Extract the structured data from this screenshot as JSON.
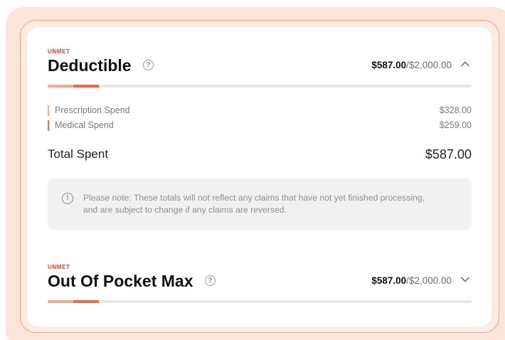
{
  "colors": {
    "accent": "#ec6d43",
    "accent_light": "#f2a98d",
    "status_red": "#d2442f",
    "track": "#ebe6e4",
    "note_bg": "#f1f1f1"
  },
  "deductible": {
    "status": "UNMET",
    "title": "Deductible",
    "help_icon": "question-circle-icon",
    "spent": "$587.00",
    "separator": "/",
    "limit": "$2,000.00",
    "toggle_icon": "chevron-up-icon",
    "progress": {
      "light_fraction": 0.06,
      "dark_fraction": 0.06
    },
    "breakdown": [
      {
        "label": "Prescription Spend",
        "value": "$328.00",
        "color": "#f2a98d"
      },
      {
        "label": "Medical Spend",
        "value": "$259.00",
        "color": "#ec6d43"
      }
    ],
    "total_label": "Total Spent",
    "total_value": "$587.00",
    "note_icon": "info-circle-icon",
    "note": "Please note: These totals will not reflect any claims that have not yet finished processing, and are subject to change if any claims are reversed."
  },
  "out_of_pocket": {
    "status": "UNMET",
    "title": "Out Of Pocket Max",
    "help_icon": "question-circle-icon",
    "spent": "$587.00",
    "separator": "/",
    "limit": "$2,000.00",
    "toggle_icon": "chevron-down-icon",
    "progress": {
      "light_fraction": 0.06,
      "dark_fraction": 0.06
    }
  }
}
